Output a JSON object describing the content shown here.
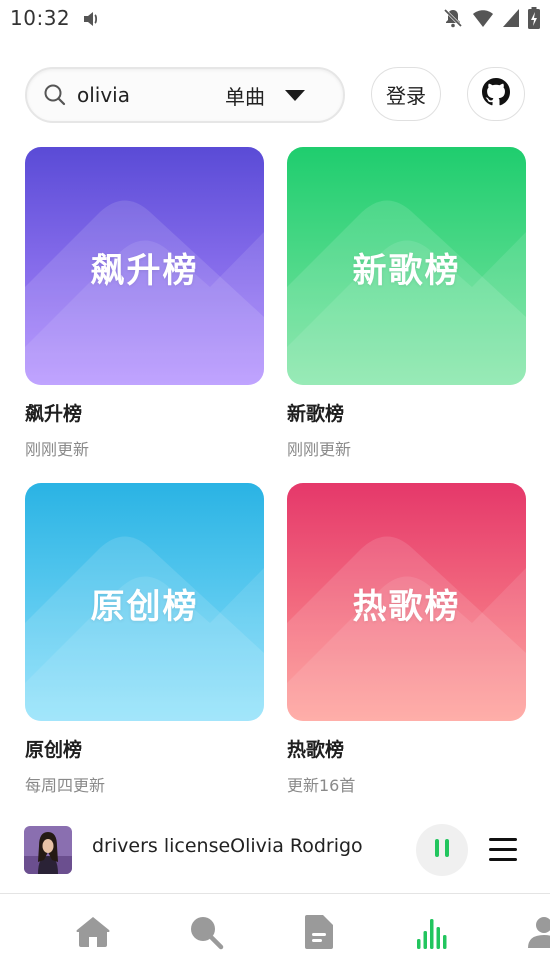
{
  "status": {
    "time": "10:32"
  },
  "search": {
    "query": "olivia",
    "type_label": "单曲"
  },
  "header": {
    "login_label": "登录"
  },
  "charts": [
    {
      "cover_text": "飙升榜",
      "title": "飙升榜",
      "subtitle": "刚刚更新",
      "color_top": "#5a4bd6",
      "color_bottom": "#b08cff"
    },
    {
      "cover_text": "新歌榜",
      "title": "新歌榜",
      "subtitle": "刚刚更新",
      "color_top": "#1fcd6e",
      "color_bottom": "#7ee5a4"
    },
    {
      "cover_text": "原创榜",
      "title": "原创榜",
      "subtitle": "每周四更新",
      "color_top": "#2ab3e4",
      "color_bottom": "#8be0fb"
    },
    {
      "cover_text": "热歌榜",
      "title": "热歌榜",
      "subtitle": "更新16首",
      "color_top": "#e5386a",
      "color_bottom": "#ff9a93"
    }
  ],
  "player": {
    "song": "drivers licenseOlivia Rodrigo",
    "accent": "#22c55e"
  },
  "nav": {
    "items": [
      {
        "icon": "home-icon",
        "active": false
      },
      {
        "icon": "search-icon",
        "active": false
      },
      {
        "icon": "document-icon",
        "active": false
      },
      {
        "icon": "chart-bars-icon",
        "active": true
      },
      {
        "icon": "user-icon",
        "active": false
      }
    ],
    "active_color": "#22c55e",
    "inactive_color": "#9a9a9a"
  }
}
